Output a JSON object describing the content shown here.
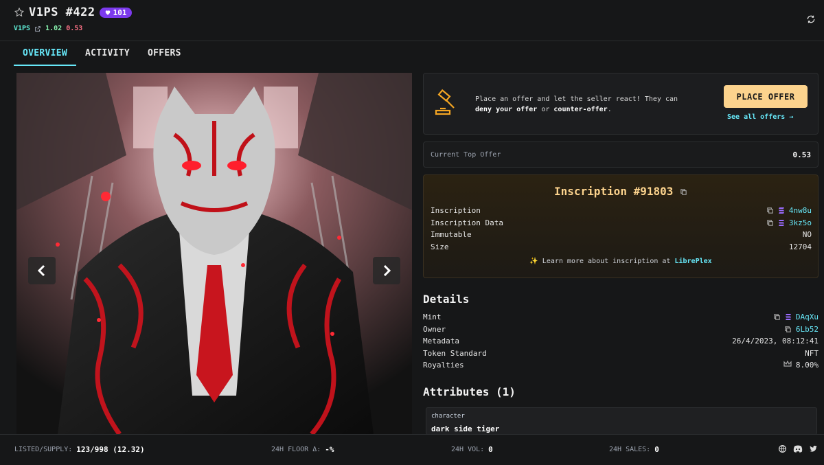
{
  "header": {
    "title": "V1PS #422",
    "favorites": "101",
    "collection_link": "V1PS",
    "price_up": "1.02",
    "price_down": "0.53"
  },
  "tabs": [
    {
      "label": "OVERVIEW"
    },
    {
      "label": "ACTIVITY"
    },
    {
      "label": "OFFERS"
    }
  ],
  "offer_card": {
    "text_1": "Place an offer and let the seller react! They can",
    "text_bold_1": "deny your offer",
    "text_mid": " or ",
    "text_bold_2": "counter-offer",
    "text_end": ".",
    "button": "PLACE OFFER",
    "see_all": "See all offers →"
  },
  "top_offer": {
    "label": "Current Top Offer",
    "value": "0.53"
  },
  "inscription": {
    "title": "Inscription #91803",
    "rows": [
      {
        "key": "Inscription",
        "value": "4nw8u"
      },
      {
        "key": "Inscription Data",
        "value": "3kz5o"
      },
      {
        "key": "Immutable",
        "value": "NO"
      },
      {
        "key": "Size",
        "value": "12704"
      }
    ],
    "learn_prefix": "✨ Learn more about inscription at ",
    "learn_link": "LibrePlex"
  },
  "details": {
    "title": "Details",
    "rows": [
      {
        "key": "Mint",
        "value": "DAqXu"
      },
      {
        "key": "Owner",
        "value": "6Lb52"
      },
      {
        "key": "Metadata",
        "value": "26/4/2023, 08:12:41"
      },
      {
        "key": "Token Standard",
        "value": "NFT"
      },
      {
        "key": "Royalties",
        "value": "8.00%"
      }
    ]
  },
  "attributes": {
    "title": "Attributes (1)",
    "items": [
      {
        "trait_type": "character",
        "value": "dark side tiger"
      }
    ]
  },
  "footer": {
    "listed_label": "LISTED/SUPPLY:",
    "listed_value": "123/998 (12.32)",
    "floor_label": "24H FLOOR Δ:",
    "floor_value": "-%",
    "vol_label": "24H VOL:",
    "vol_value": "0",
    "sales_label": "24H SALES:",
    "sales_value": "0"
  },
  "colors": {
    "accent": "#67e8f9",
    "offer_button": "#fcd38d",
    "badge": "#7c3aed"
  }
}
